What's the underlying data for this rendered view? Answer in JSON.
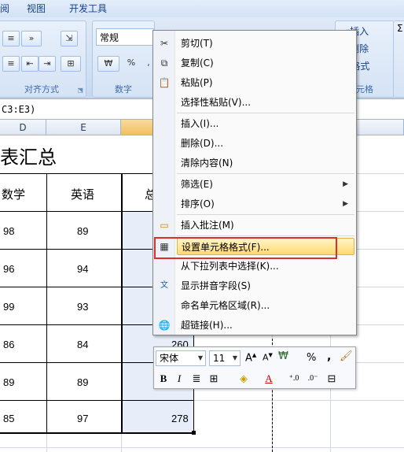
{
  "menu_tabs": [
    "视图",
    "开发工具"
  ],
  "menu_tabs_partial_left": "阅",
  "ribbon": {
    "number_format": "常规",
    "align_group_label": "对齐方式",
    "number_group_label": "数字",
    "cells_group_label": "元格",
    "insert_label": "插入",
    "delete_label": "删除",
    "format_label": "格式",
    "percent": "%",
    "comma": ","
  },
  "formula_text": "C3:E3)",
  "columns": [
    {
      "label": "D",
      "selected": false
    },
    {
      "label": "E",
      "selected": false
    },
    {
      "label": "",
      "selected": true
    }
  ],
  "sheet": {
    "title": "表汇总",
    "headers": [
      "数学",
      "英语",
      "总"
    ],
    "rows": [
      {
        "math": "98",
        "english": "89",
        "total": ""
      },
      {
        "math": "96",
        "english": "94",
        "total": ""
      },
      {
        "math": "99",
        "english": "93",
        "total": ""
      },
      {
        "math": "86",
        "english": "84",
        "total": "260"
      },
      {
        "math": "89",
        "english": "89",
        "total": ""
      },
      {
        "math": "85",
        "english": "97",
        "total": "278"
      }
    ]
  },
  "context_menu": {
    "items": [
      {
        "label": "剪切(T)",
        "icon": "scissors-icon"
      },
      {
        "label": "复制(C)",
        "icon": "copy-icon"
      },
      {
        "label": "粘贴(P)",
        "icon": "paste-icon"
      },
      {
        "label": "选择性粘贴(V)...",
        "icon": ""
      },
      {
        "label": "插入(I)...",
        "icon": ""
      },
      {
        "label": "删除(D)...",
        "icon": ""
      },
      {
        "label": "清除内容(N)",
        "icon": ""
      },
      {
        "label": "筛选(E)",
        "icon": "",
        "submenu": true
      },
      {
        "label": "排序(O)",
        "icon": "",
        "submenu": true
      },
      {
        "label": "插入批注(M)",
        "icon": "comment-icon"
      },
      {
        "label": "设置单元格格式(F)...",
        "icon": "format-cells-icon",
        "highlighted": true
      },
      {
        "label": "从下拉列表中选择(K)...",
        "icon": ""
      },
      {
        "label": "显示拼音字段(S)",
        "icon": "phonetic-icon"
      },
      {
        "label": "命名单元格区域(R)...",
        "icon": ""
      },
      {
        "label": "超链接(H)...",
        "icon": "hyperlink-icon"
      }
    ]
  },
  "mini_toolbar": {
    "font_name": "宋体",
    "font_size": "11",
    "bold": "B",
    "italic": "I",
    "percent": "%",
    "comma": ","
  },
  "colors": {
    "highlight_border": "#d9302b",
    "menu_highlight": "#ffd970",
    "selected_column": "#e7eef9"
  }
}
